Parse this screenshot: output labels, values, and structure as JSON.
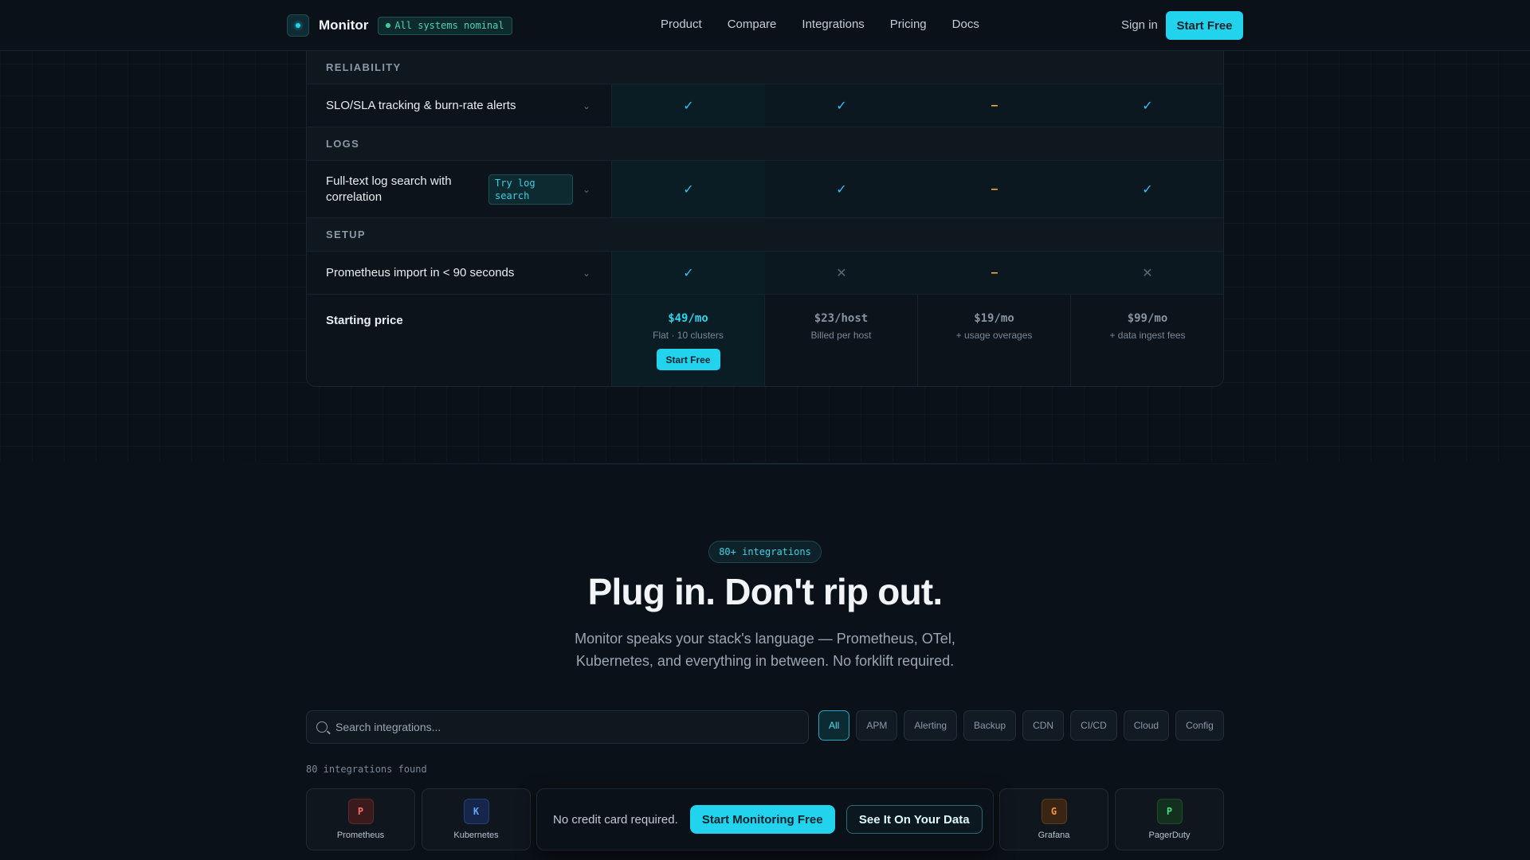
{
  "nav": {
    "brand": "Monitor",
    "status": "All systems nominal",
    "links": [
      "Product",
      "Compare",
      "Integrations",
      "Pricing",
      "Docs"
    ],
    "signin": "Sign in",
    "cta": "Start Free"
  },
  "table": {
    "sections": [
      {
        "label": "RELIABILITY",
        "feature": "SLO/SLA tracking & burn-rate alerts",
        "values": [
          "check",
          "check",
          "dash",
          "check"
        ]
      },
      {
        "label": "LOGS",
        "feature": "Full-text log search with correlation",
        "tag": "Try log search",
        "values": [
          "check",
          "check",
          "dash",
          "check"
        ]
      },
      {
        "label": "SETUP",
        "feature": "Prometheus import in < 90 seconds",
        "values": [
          "check",
          "cross",
          "dash",
          "cross"
        ]
      }
    ],
    "price_row": {
      "label": "Starting price",
      "prices": [
        {
          "value": "$49/mo",
          "note": "Flat · 10 clusters",
          "button": "Start Free"
        },
        {
          "value": "$23/host",
          "note": "Billed per host"
        },
        {
          "value": "$19/mo",
          "note": "+ usage overages"
        },
        {
          "value": "$99/mo",
          "note": "+ data ingest fees"
        }
      ]
    }
  },
  "integrations": {
    "badge": "80+ integrations",
    "title": "Plug in. Don't rip out.",
    "subtitle": "Monitor speaks your stack's language — Prometheus, OTel, Kubernetes, and everything in between. No forklift required.",
    "search_placeholder": "Search integrations...",
    "filters": [
      "All",
      "APM",
      "Alerting",
      "Backup",
      "CDN",
      "CI/CD",
      "Cloud",
      "Config"
    ],
    "active_filter": "All",
    "count_text": "80 integrations found",
    "cards": [
      {
        "letter": "P",
        "name": "Prometheus",
        "color": "#f87171",
        "bg": "#3a1a1a"
      },
      {
        "letter": "K",
        "name": "Kubernetes",
        "color": "#60a5fa",
        "bg": "#16264a"
      },
      {
        "letter": "G",
        "name": "Grafana",
        "color": "#fb923c",
        "bg": "#3a2414"
      },
      {
        "letter": "P",
        "name": "PagerDuty",
        "color": "#4ade80",
        "bg": "#13301f"
      }
    ]
  },
  "cta_bar": {
    "note": "No credit card required.",
    "primary": "Start Monitoring Free",
    "secondary": "See It On Your Data"
  },
  "colors": {
    "accent": "#22d3ee",
    "check": "#38bdf8",
    "dash": "#f5b544",
    "background": "#0b1118"
  }
}
